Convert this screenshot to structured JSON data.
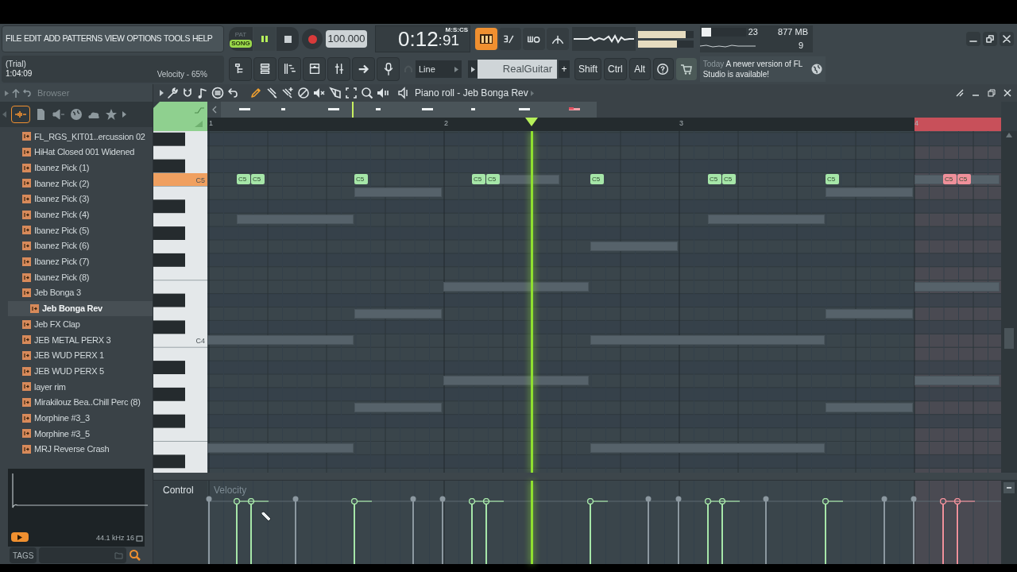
{
  "menu": [
    "FILE",
    "EDIT",
    "ADD",
    "PATTERNS",
    "VIEW",
    "OPTIONS",
    "TOOLS",
    "HELP"
  ],
  "transport": {
    "modes": [
      {
        "label": "PAT",
        "selected": false
      },
      {
        "label": "SONG",
        "selected": true
      }
    ],
    "playing": true,
    "recording": false,
    "tempo": "100.000",
    "time_main": "0:12",
    "time_fraction": ":91",
    "time_format": "M:S:CS"
  },
  "output_meters": [
    {
      "level": 0.85
    },
    {
      "level": 0.7
    }
  ],
  "monitor": {
    "cpu": "23",
    "cpu_meter": {
      "level": 0.22
    },
    "memory": "877 MB",
    "polyphony": "9"
  },
  "hint": {
    "title": "(Trial)",
    "time": "1:04:09",
    "message": "Velocity - 65%"
  },
  "snap": "Line",
  "preset": "RealGuitar",
  "add_label": "+",
  "modifier_keys": [
    "Shift",
    "Ctrl",
    "Alt"
  ],
  "news": {
    "when": "Today",
    "text": "A newer version of FL Studio is available!"
  },
  "browser": {
    "title": "Browser",
    "items": [
      {
        "label": "FL_RGS_KIT01..ercussion 02",
        "selected": false
      },
      {
        "label": "HiHat Closed 001 Widened",
        "selected": false
      },
      {
        "label": "Ibanez Pick (1)",
        "selected": false
      },
      {
        "label": "Ibanez Pick (2)",
        "selected": false
      },
      {
        "label": "Ibanez Pick (3)",
        "selected": false
      },
      {
        "label": "Ibanez Pick (4)",
        "selected": false
      },
      {
        "label": "Ibanez Pick (5)",
        "selected": false
      },
      {
        "label": "Ibanez Pick (6)",
        "selected": false
      },
      {
        "label": "Ibanez Pick (7)",
        "selected": false
      },
      {
        "label": "Ibanez Pick (8)",
        "selected": false
      },
      {
        "label": "Jeb Bonga 3",
        "selected": false
      },
      {
        "label": "Jeb Bonga Rev",
        "selected": true
      },
      {
        "label": "Jeb FX Clap",
        "selected": false
      },
      {
        "label": "JEB METAL PERX 3",
        "selected": false
      },
      {
        "label": "JEB WUD PERX 1",
        "selected": false
      },
      {
        "label": "JEB WUD PERX 5",
        "selected": false
      },
      {
        "label": "layer rim",
        "selected": false
      },
      {
        "label": "Mirakilouz Bea..Chill Perc (8)",
        "selected": false
      },
      {
        "label": "Morphine #3_3",
        "selected": false
      },
      {
        "label": "Morphine #3_5",
        "selected": false
      },
      {
        "label": "MRJ Reverse Crash",
        "selected": false
      }
    ],
    "sample_info": "44.1 kHz 16",
    "tags": "TAGS"
  },
  "piano_roll": {
    "title": "Piano roll - Jeb Bonga Rev",
    "tools": [
      {
        "kind": "draw",
        "selected": true
      },
      {
        "kind": "paint",
        "selected": false
      },
      {
        "kind": "paint_add",
        "selected": false
      },
      {
        "kind": "delete",
        "selected": false
      },
      {
        "kind": "mute",
        "selected": false
      },
      {
        "kind": "slice",
        "selected": false
      },
      {
        "kind": "select",
        "selected": false
      },
      {
        "kind": "zoom",
        "selected": false
      },
      {
        "kind": "playback",
        "selected": false
      }
    ],
    "ruler": [
      "1",
      "2",
      "3",
      "4"
    ],
    "keys": [
      {
        "label": "C5",
        "pressed": true
      },
      {
        "label": "C4",
        "pressed": false
      }
    ],
    "notes": [
      {
        "label": "C5",
        "color": "#a6e6a8"
      },
      {
        "label": "C5",
        "color": "#a6e6a8"
      },
      {
        "label": "C5",
        "color": "#a6e6a8"
      },
      {
        "label": "C5",
        "color": "#a6e6a8"
      },
      {
        "label": "C5",
        "color": "#a6e6a8"
      },
      {
        "label": "C5",
        "color": "#a6e6a8"
      },
      {
        "label": "C5",
        "color": "#a6e6a8"
      },
      {
        "label": "C5",
        "color": "#a6e6a8"
      },
      {
        "label": "C5",
        "color": "#a6e6a8"
      },
      {
        "label": "C5",
        "color": "#f0909a"
      },
      {
        "label": "C5",
        "color": "#f0909a"
      }
    ],
    "control": {
      "label": "Control",
      "parameter": "Velocity"
    }
  }
}
